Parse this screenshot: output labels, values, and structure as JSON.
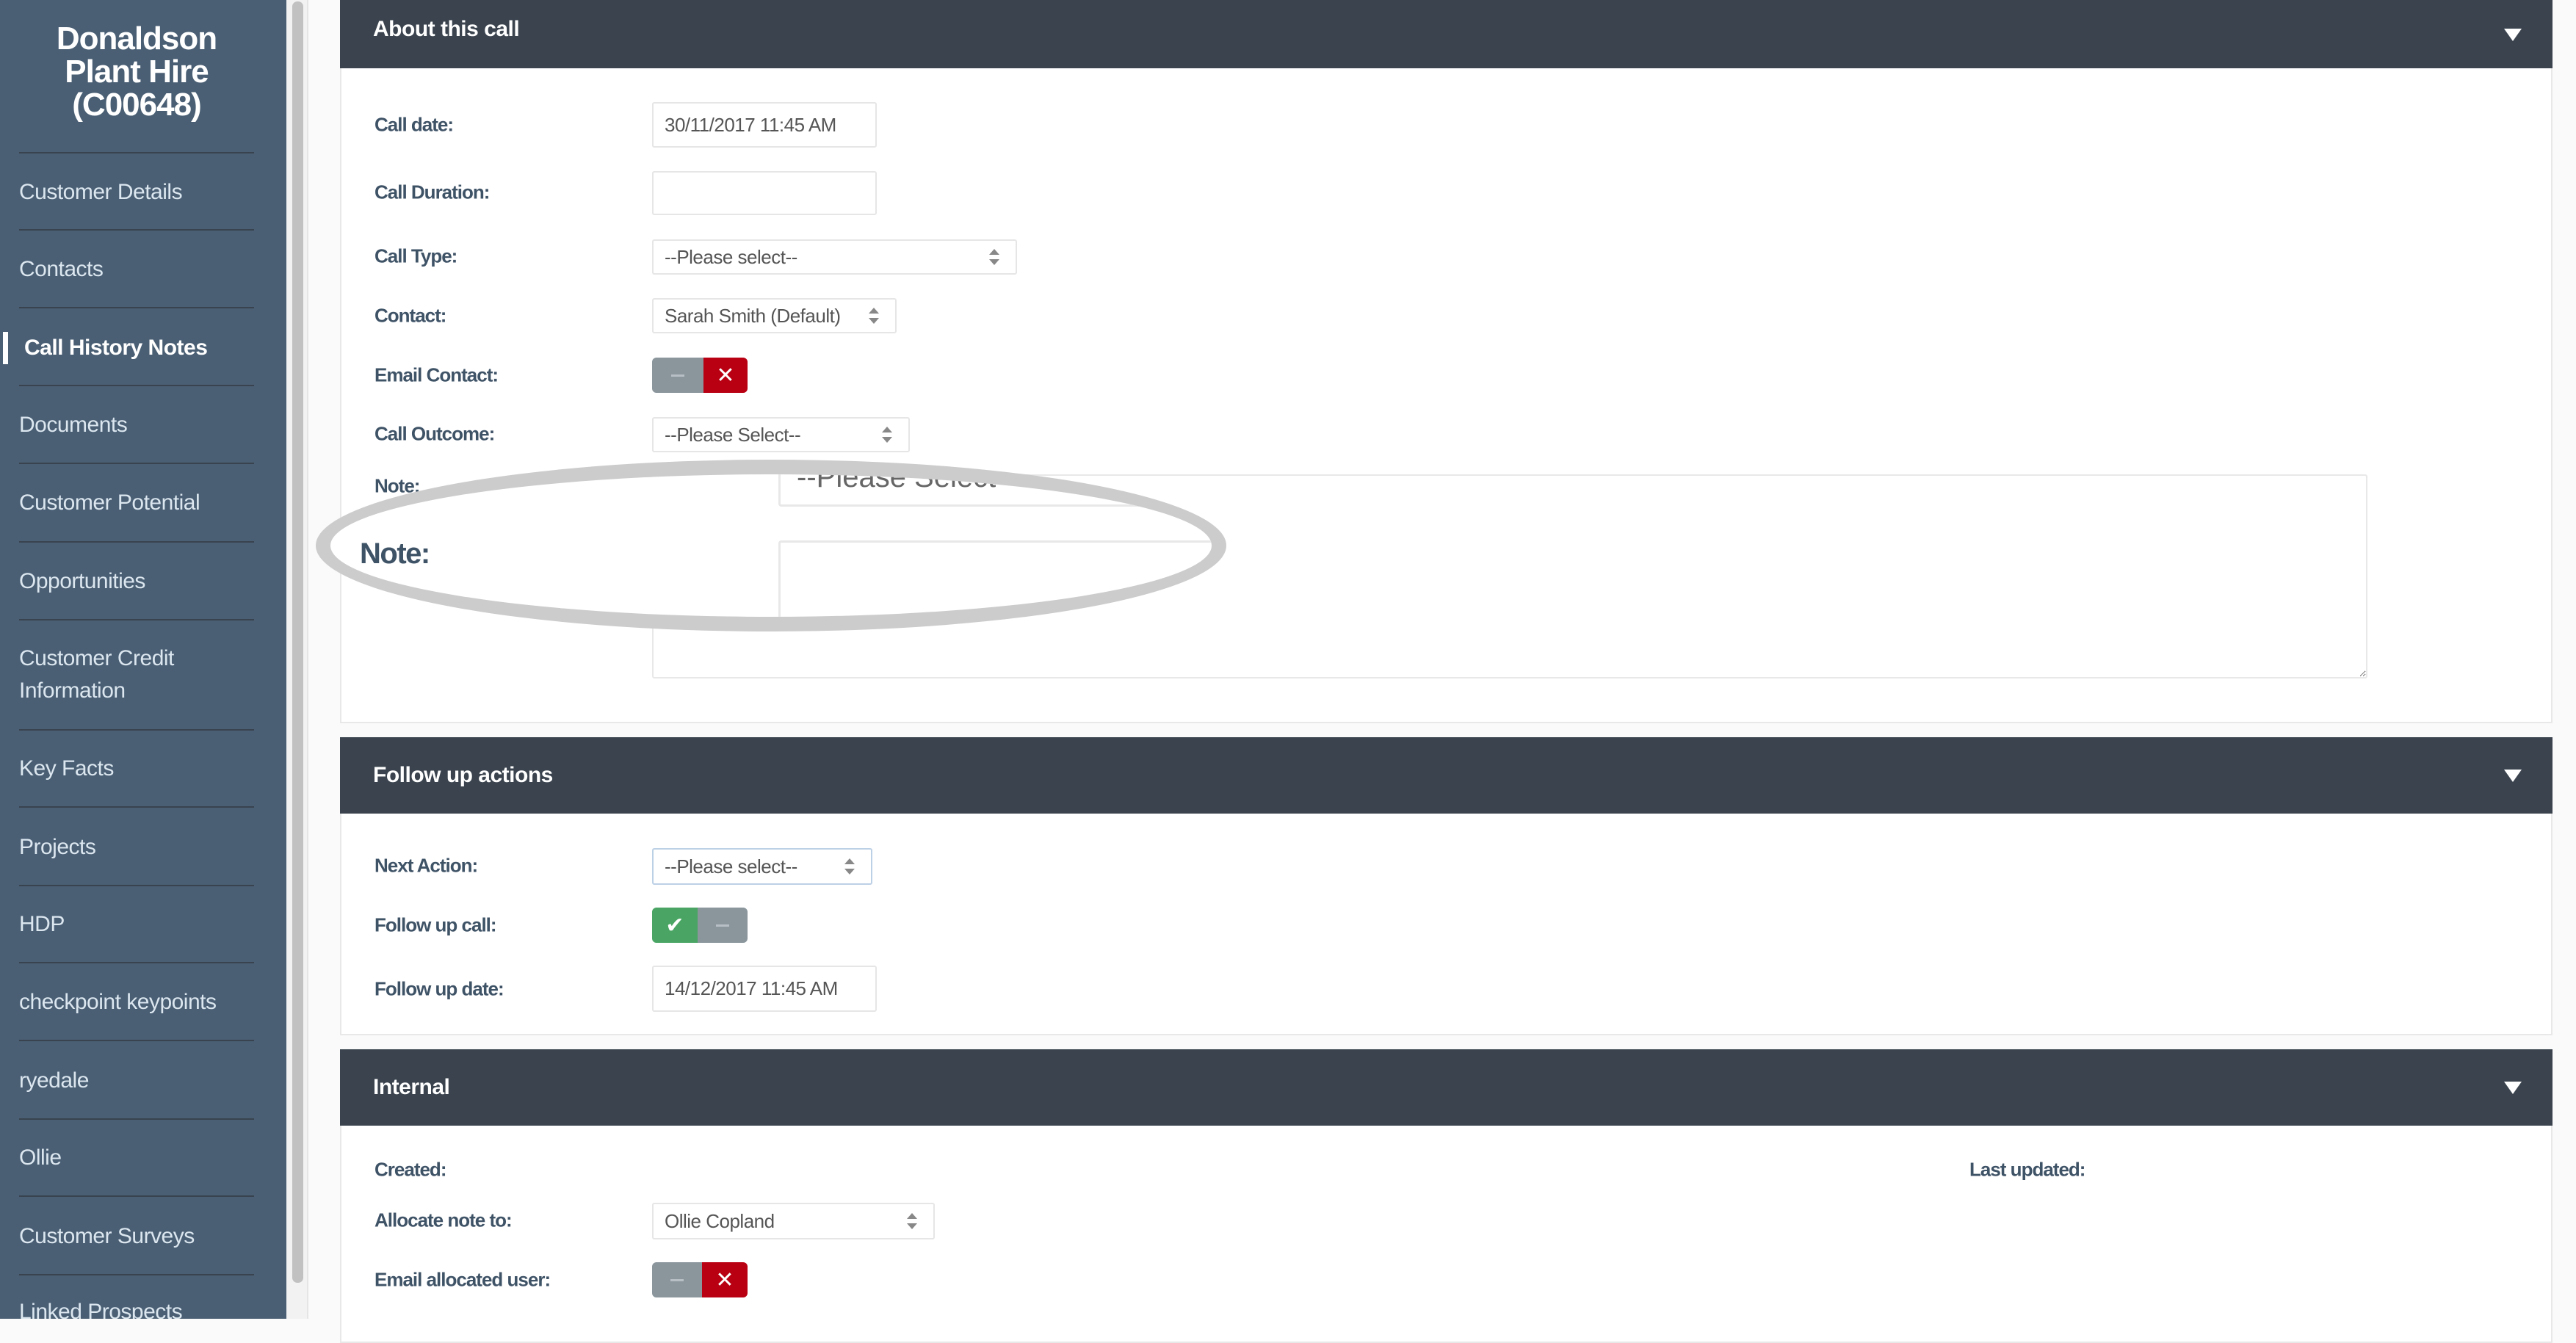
{
  "sidebar": {
    "company_name": [
      "Donaldson",
      "Plant Hire",
      "(C00648)"
    ],
    "items": [
      {
        "label": "Customer Details"
      },
      {
        "label": "Contacts"
      },
      {
        "label": "Call History Notes",
        "active": true
      },
      {
        "label": "Documents"
      },
      {
        "label": "Customer Potential"
      },
      {
        "label": "Opportunities"
      },
      {
        "label": "Customer Credit Information"
      },
      {
        "label": "Key Facts"
      },
      {
        "label": "Projects"
      },
      {
        "label": "HDP"
      },
      {
        "label": "checkpoint keypoints"
      },
      {
        "label": "ryedale"
      },
      {
        "label": "Ollie"
      },
      {
        "label": "Customer Surveys"
      },
      {
        "label": "Linked Prospects"
      }
    ]
  },
  "about_call": {
    "title": "About this call",
    "call_date_label": "Call date:",
    "call_date_value": "30/11/2017 11:45 AM",
    "call_duration_label": "Call Duration:",
    "call_duration_value": "",
    "call_type_label": "Call Type:",
    "call_type_value": "--Please select--",
    "contact_label": "Contact:",
    "contact_value": "Sarah Smith (Default)",
    "email_contact_label": "Email Contact:",
    "email_contact_state": "off",
    "call_outcome_label": "Call Outcome:",
    "call_outcome_value": "--Please Select--",
    "note_label": "Note:",
    "note_value": ""
  },
  "magnifier": {
    "label": "Note:",
    "select_text": "--Please Select--"
  },
  "follow_up": {
    "title": "Follow up actions",
    "next_action_label": "Next Action:",
    "next_action_value": "--Please select--",
    "follow_up_call_label": "Follow up call:",
    "follow_up_call_state": "on",
    "follow_up_date_label": "Follow up date:",
    "follow_up_date_value": "14/12/2017 11:45 AM"
  },
  "internal": {
    "title": "Internal",
    "created_label": "Created:",
    "last_updated_label": "Last updated:",
    "allocate_label": "Allocate note to:",
    "allocate_value": "Ollie Copland",
    "email_allocated_label": "Email allocated user:",
    "email_allocated_state": "off"
  },
  "icons": {
    "toggle_off": "✕",
    "toggle_on": "✔",
    "collapse": "triangle-down"
  },
  "colors": {
    "sidebar_bg": "#4a5f74",
    "header_bg": "#3a434e",
    "toggle_red": "#b80012",
    "toggle_green": "#4aa564",
    "toggle_gray": "#8a959c"
  }
}
